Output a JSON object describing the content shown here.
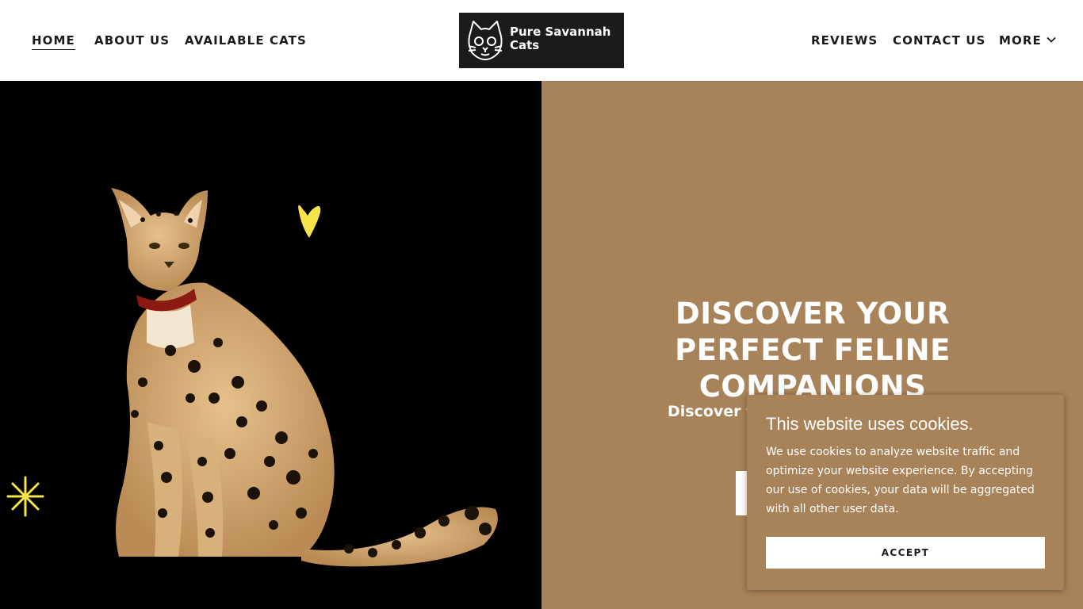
{
  "nav": {
    "left": [
      "HOME",
      "ABOUT US",
      "AVAILABLE CATS"
    ],
    "right": [
      "REVIEWS",
      "CONTACT US",
      "MORE"
    ],
    "active": "HOME"
  },
  "logo": {
    "text": "Pure Savannah Cats"
  },
  "hero": {
    "title": "DISCOVER YOUR PERFECT FELINE COMPANIONS",
    "subtitle": "Discover th",
    "image_subject": "serval cat on black background"
  },
  "cookie": {
    "title": "This website uses cookies.",
    "body": "We use cookies to analyze website traffic and optimize your website experience. By accepting our use of cookies, your data will be aggregated with all other user data.",
    "accept_label": "ACCEPT"
  },
  "colors": {
    "accent": "#a88258",
    "header_bg": "#ffffff",
    "text_dark": "#1b1b1b",
    "hero_image_bg": "#000000"
  },
  "icons": [
    "cat-face-icon",
    "chevron-down-icon",
    "heart-icon",
    "sparkle-icon"
  ]
}
